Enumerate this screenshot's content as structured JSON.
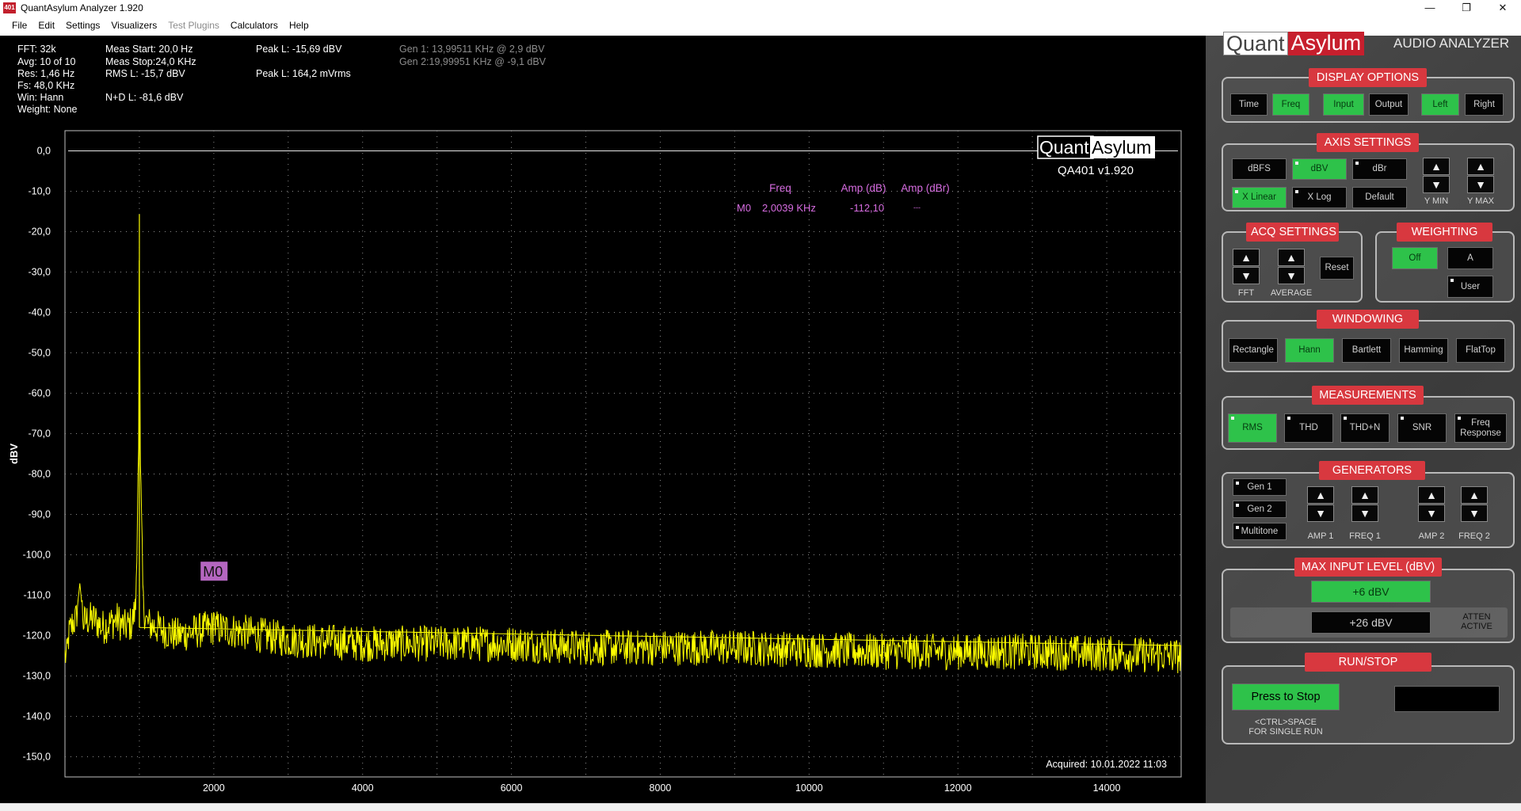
{
  "titlebar": {
    "icon_text": "401",
    "title": "QuantAsylum Analyzer 1.920",
    "minimize": "—",
    "restore": "❐",
    "close": "✕"
  },
  "menu": [
    "File",
    "Edit",
    "Settings",
    "Visualizers",
    "Test Plugins",
    "Calculators",
    "Help"
  ],
  "stats": {
    "fft": "FFT: 32k",
    "avg": "Avg: 10 of 10",
    "res": "Res: 1,46 Hz",
    "fs": "Fs: 48,0 KHz",
    "win": "Win: Hann",
    "weight": "Weight: None",
    "meas_start": "Meas Start: 20,0 Hz",
    "meas_stop": "Meas Stop:24,0 KHz",
    "rms": "RMS L: -15,7 dBV",
    "nd": "N+D L: -81,6 dBV",
    "peak_l": "Peak L: -15,69 dBV",
    "peak_mvrms": "Peak L: 164,2 mVrms",
    "gen1": "Gen 1: 13,99511 KHz @ 2,9   dBV",
    "gen2": "Gen 2:19,99951 KHz @ -9,1   dBV"
  },
  "plot_overlay": {
    "logo_quant": "Quant",
    "logo_asylum": "Asylum",
    "version": "QA401 v1.920",
    "marker_headers": [
      "Freq",
      "Amp (dB)",
      "Amp (dBr)"
    ],
    "marker_row": {
      "name": "M0",
      "freq": "2,0039 KHz",
      "amp_db": "-112,10",
      "amp_dbr": "---"
    },
    "marker_label": "M0",
    "acquired": "Acquired: 10.01.2022  11:03"
  },
  "chart_data": {
    "type": "line",
    "title": "",
    "xlabel": "",
    "ylabel": "dBV",
    "xlim": [
      0,
      15000
    ],
    "ylim": [
      -155,
      5
    ],
    "x_ticks": [
      2000,
      4000,
      6000,
      8000,
      10000,
      12000,
      14000
    ],
    "y_ticks": [
      "0,0",
      "-10,0",
      "-20,0",
      "-30,0",
      "-40,0",
      "-50,0",
      "-60,0",
      "-70,0",
      "-80,0",
      "-90,0",
      "-100,0",
      "-110,0",
      "-120,0",
      "-130,0",
      "-140,0",
      "-150,0"
    ],
    "y_tick_values": [
      0,
      -10,
      -20,
      -30,
      -40,
      -50,
      -60,
      -70,
      -80,
      -90,
      -100,
      -110,
      -120,
      -130,
      -140,
      -150
    ],
    "grid": true,
    "reference_line_db": 0,
    "series": [
      {
        "color": "#ffff00",
        "points": [
          [
            20,
            -126
          ],
          [
            50,
            -120
          ],
          [
            100,
            -117
          ],
          [
            150,
            -116
          ],
          [
            200,
            -107
          ],
          [
            250,
            -117
          ],
          [
            300,
            -116
          ],
          [
            400,
            -116
          ],
          [
            500,
            -118
          ],
          [
            600,
            -117
          ],
          [
            700,
            -116
          ],
          [
            800,
            -118
          ],
          [
            900,
            -117
          ],
          [
            950,
            -113
          ],
          [
            990,
            -74
          ],
          [
            1000,
            -15.69
          ],
          [
            1010,
            -74
          ],
          [
            1050,
            -112
          ],
          [
            1100,
            -117
          ],
          [
            1500,
            -120
          ],
          [
            1990,
            -118
          ],
          [
            2000,
            -112
          ],
          [
            2010,
            -118
          ],
          [
            3000,
            -121
          ],
          [
            4000,
            -122
          ],
          [
            5000,
            -122
          ],
          [
            6000,
            -122
          ],
          [
            7000,
            -123
          ],
          [
            8000,
            -123
          ],
          [
            9000,
            -123
          ],
          [
            10000,
            -123.5
          ],
          [
            11000,
            -124
          ],
          [
            12000,
            -124
          ],
          [
            13000,
            -124
          ],
          [
            14000,
            -124.5
          ],
          [
            15000,
            -125
          ]
        ]
      }
    ],
    "marker": {
      "name": "M0",
      "x": 2003.9,
      "y": -112.1
    }
  },
  "panel": {
    "logo_quant": "Quant",
    "logo_asylum": "Asylum",
    "logo_sub": "AUDIO ANALYZER",
    "display_options": {
      "header": "DISPLAY OPTIONS",
      "time": "Time",
      "freq": "Freq",
      "input": "Input",
      "output": "Output",
      "left": "Left",
      "right": "Right"
    },
    "axis_settings": {
      "header": "AXIS SETTINGS",
      "dbfs": "dBFS",
      "dbv": "dBV",
      "dbr": "dBr",
      "x_linear": "X Linear",
      "x_log": "X Log",
      "default": "Default",
      "y_min": "Y MIN",
      "y_max": "Y MAX"
    },
    "acq_settings": {
      "header": "ACQ SETTINGS",
      "fft": "FFT",
      "average": "AVERAGE",
      "reset": "Reset"
    },
    "weighting": {
      "header": "WEIGHTING",
      "off": "Off",
      "a": "A",
      "user": "User"
    },
    "windowing": {
      "header": "WINDOWING",
      "rectangle": "Rectangle",
      "hann": "Hann",
      "bartlett": "Bartlett",
      "hamming": "Hamming",
      "flattop": "FlatTop"
    },
    "measurements": {
      "header": "MEASUREMENTS",
      "rms": "RMS",
      "thd": "THD",
      "thdn": "THD+N",
      "snr": "SNR",
      "freq_response_1": "Freq",
      "freq_response_2": "Response"
    },
    "generators": {
      "header": "GENERATORS",
      "gen1": "Gen 1",
      "gen2": "Gen 2",
      "multitone": "Multitone",
      "amp1": "AMP 1",
      "freq1": "FREQ 1",
      "amp2": "AMP 2",
      "freq2": "FREQ 2"
    },
    "max_input": {
      "header": "MAX INPUT LEVEL (dBV)",
      "plus6": "+6 dBV",
      "plus26": "+26 dBV",
      "atten_1": "ATTEN",
      "atten_2": "ACTIVE"
    },
    "run_stop": {
      "header": "RUN/STOP",
      "press_to_stop": "Press to Stop",
      "hint_1": "<CTRL>SPACE",
      "hint_2": "FOR SINGLE RUN"
    },
    "arrow_up": "▲",
    "arrow_down": "▼"
  }
}
